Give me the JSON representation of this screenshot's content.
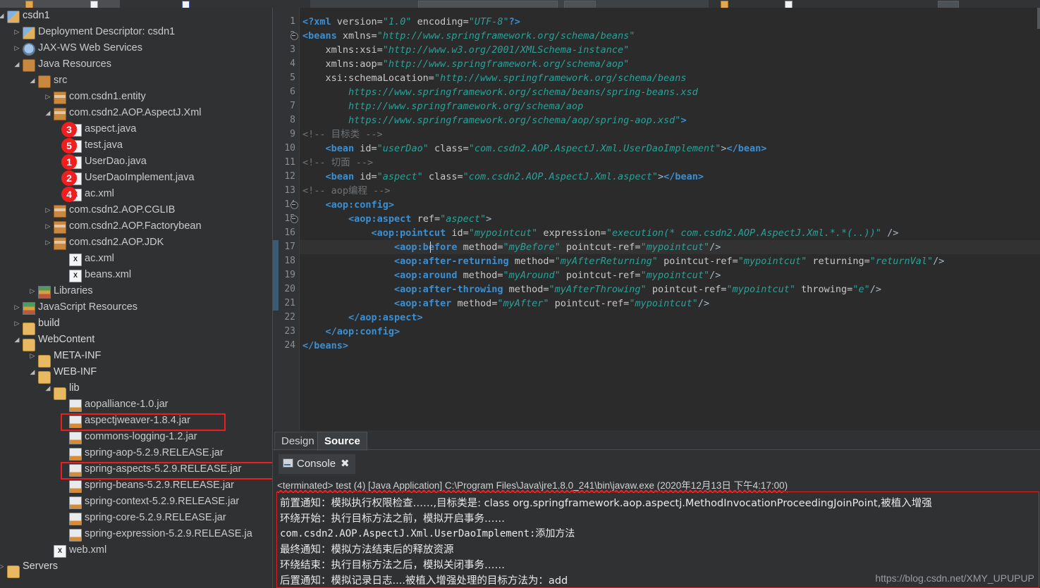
{
  "window": {
    "watermark": "https://blog.csdn.net/XMY_UPUPUP"
  },
  "explorer": {
    "name": "package-explorer",
    "rows": [
      {
        "label": "csdn1",
        "icon": "project-icon",
        "arrow": "◢",
        "indent": 0
      },
      {
        "label": "Deployment Descriptor: csdn1",
        "icon": "deployment-descriptor-icon",
        "arrow": "▷",
        "indent": 1
      },
      {
        "label": "JAX-WS Web Services",
        "icon": "web-services-icon",
        "arrow": "▷",
        "indent": 1
      },
      {
        "label": "Java Resources",
        "icon": "java-resources-icon",
        "arrow": "◢",
        "indent": 1
      },
      {
        "label": "src",
        "icon": "source-folder-icon",
        "arrow": "◢",
        "indent": 2
      },
      {
        "label": "com.csdn1.entity",
        "icon": "package-icon",
        "arrow": "▷",
        "indent": 3
      },
      {
        "label": "com.csdn2.AOP.AspectJ.Xml",
        "icon": "package-icon",
        "arrow": "◢",
        "indent": 3
      },
      {
        "label": "aspect.java",
        "icon": "java-file-icon",
        "arrow": "",
        "indent": 4,
        "badge": "3"
      },
      {
        "label": "test.java",
        "icon": "java-file-icon",
        "arrow": "",
        "indent": 4,
        "badge": "5"
      },
      {
        "label": "UserDao.java",
        "icon": "java-interface-icon",
        "arrow": "",
        "indent": 4,
        "badge": "1"
      },
      {
        "label": "UserDaoImplement.java",
        "icon": "java-file-icon",
        "arrow": "",
        "indent": 4,
        "badge": "2"
      },
      {
        "label": "ac.xml",
        "icon": "xml-file-icon",
        "arrow": "",
        "indent": 4,
        "badge": "4"
      },
      {
        "label": "com.csdn2.AOP.CGLIB",
        "icon": "package-icon",
        "arrow": "▷",
        "indent": 3
      },
      {
        "label": "com.csdn2.AOP.Factorybean",
        "icon": "package-icon",
        "arrow": "▷",
        "indent": 3
      },
      {
        "label": "com.csdn2.AOP.JDK",
        "icon": "package-icon",
        "arrow": "▷",
        "indent": 3
      },
      {
        "label": "ac.xml",
        "icon": "xml-file-icon",
        "arrow": "",
        "indent": 4
      },
      {
        "label": "beans.xml",
        "icon": "xml-file-icon",
        "arrow": "",
        "indent": 4
      },
      {
        "label": "Libraries",
        "icon": "libraries-icon",
        "arrow": "▷",
        "indent": 2
      },
      {
        "label": "JavaScript Resources",
        "icon": "libraries-icon",
        "arrow": "▷",
        "indent": 1
      },
      {
        "label": "build",
        "icon": "folder-icon",
        "arrow": "▷",
        "indent": 1
      },
      {
        "label": "WebContent",
        "icon": "folder-icon",
        "arrow": "◢",
        "indent": 1
      },
      {
        "label": "META-INF",
        "icon": "folder-icon",
        "arrow": "▷",
        "indent": 2
      },
      {
        "label": "WEB-INF",
        "icon": "folder-icon",
        "arrow": "◢",
        "indent": 2
      },
      {
        "label": "lib",
        "icon": "folder-icon",
        "arrow": "◢",
        "indent": 3
      },
      {
        "label": "aopalliance-1.0.jar",
        "icon": "jar-icon",
        "arrow": "",
        "indent": 4
      },
      {
        "label": "aspectjweaver-1.8.4.jar",
        "icon": "jar-icon",
        "arrow": "",
        "indent": 4,
        "highlight": true
      },
      {
        "label": "commons-logging-1.2.jar",
        "icon": "jar-icon",
        "arrow": "",
        "indent": 4
      },
      {
        "label": "spring-aop-5.2.9.RELEASE.jar",
        "icon": "jar-icon",
        "arrow": "",
        "indent": 4
      },
      {
        "label": "spring-aspects-5.2.9.RELEASE.jar",
        "icon": "jar-icon",
        "arrow": "",
        "indent": 4,
        "highlight": true
      },
      {
        "label": "spring-beans-5.2.9.RELEASE.jar",
        "icon": "jar-icon",
        "arrow": "",
        "indent": 4
      },
      {
        "label": "spring-context-5.2.9.RELEASE.jar",
        "icon": "jar-icon",
        "arrow": "",
        "indent": 4
      },
      {
        "label": "spring-core-5.2.9.RELEASE.jar",
        "icon": "jar-icon",
        "arrow": "",
        "indent": 4
      },
      {
        "label": "spring-expression-5.2.9.RELEASE.ja",
        "icon": "jar-icon",
        "arrow": "",
        "indent": 4
      },
      {
        "label": "web.xml",
        "icon": "xml-file-icon",
        "arrow": "",
        "indent": 3
      },
      {
        "label": "Servers",
        "icon": "folder-icon",
        "arrow": "▷",
        "indent": 0
      }
    ]
  },
  "editor": {
    "name": "xml-source-editor",
    "current_line": 17,
    "fold_lines": [
      2,
      14,
      15
    ],
    "lines": [
      {
        "n": "1",
        "segs": [
          {
            "t": "<?",
            "c": "tg"
          },
          {
            "t": "xml",
            "c": "tg"
          },
          {
            "t": " version=",
            "c": "at"
          },
          {
            "t": "\"1.0\"",
            "c": "vl"
          },
          {
            "t": " encoding=",
            "c": "at"
          },
          {
            "t": "\"UTF-8\"",
            "c": "vl"
          },
          {
            "t": "?>",
            "c": "tg"
          }
        ]
      },
      {
        "n": "2",
        "segs": [
          {
            "t": "<beans",
            "c": "tg"
          },
          {
            "t": " xmlns=",
            "c": "at"
          },
          {
            "t": "\"http://www.springframework.org/schema/beans\"",
            "c": "vl"
          }
        ]
      },
      {
        "n": "3",
        "segs": [
          {
            "t": "    xmlns:xsi=",
            "c": "at"
          },
          {
            "t": "\"http://www.w3.org/2001/XMLSchema-instance\"",
            "c": "vl"
          }
        ]
      },
      {
        "n": "4",
        "segs": [
          {
            "t": "    xmlns:aop=",
            "c": "at"
          },
          {
            "t": "\"http://www.springframework.org/schema/aop\"",
            "c": "vl"
          }
        ]
      },
      {
        "n": "5",
        "segs": [
          {
            "t": "    xsi:schemaLocation=",
            "c": "at"
          },
          {
            "t": "\"http://www.springframework.org/schema/beans",
            "c": "vl"
          }
        ]
      },
      {
        "n": "6",
        "segs": [
          {
            "t": "        https://www.springframework.org/schema/beans/spring-beans.xsd",
            "c": "vl"
          }
        ]
      },
      {
        "n": "7",
        "segs": [
          {
            "t": "        http://www.springframework.org/schema/aop",
            "c": "vl"
          }
        ]
      },
      {
        "n": "8",
        "segs": [
          {
            "t": "        https://www.springframework.org/schema/aop/spring-aop.xsd\"",
            "c": "vl"
          },
          {
            "t": ">",
            "c": "tg"
          }
        ]
      },
      {
        "n": "9",
        "segs": [
          {
            "t": "<!-- 目标类 -->",
            "c": "cm"
          }
        ]
      },
      {
        "n": "10",
        "segs": [
          {
            "t": "    <bean",
            "c": "tg"
          },
          {
            "t": " id=",
            "c": "at"
          },
          {
            "t": "\"userDao\"",
            "c": "vl"
          },
          {
            "t": " class=",
            "c": "at"
          },
          {
            "t": "\"com.csdn2.AOP.AspectJ.Xml.UserDaoImplement\"",
            "c": "vl"
          },
          {
            "t": ">",
            "c": "pl"
          },
          {
            "t": "</bean>",
            "c": "tg"
          }
        ]
      },
      {
        "n": "11",
        "segs": [
          {
            "t": "<!-- 切面 -->",
            "c": "cm"
          }
        ]
      },
      {
        "n": "12",
        "segs": [
          {
            "t": "    <bean",
            "c": "tg"
          },
          {
            "t": " id=",
            "c": "at"
          },
          {
            "t": "\"aspect\"",
            "c": "vl"
          },
          {
            "t": " class=",
            "c": "at"
          },
          {
            "t": "\"com.csdn2.AOP.AspectJ.Xml.aspect\"",
            "c": "vl"
          },
          {
            "t": ">",
            "c": "pl"
          },
          {
            "t": "</bean>",
            "c": "tg"
          }
        ]
      },
      {
        "n": "13",
        "segs": [
          {
            "t": "<!-- aop编程 -->",
            "c": "cm"
          }
        ]
      },
      {
        "n": "14",
        "segs": [
          {
            "t": "    <aop:config>",
            "c": "tg"
          }
        ]
      },
      {
        "n": "15",
        "segs": [
          {
            "t": "        <aop:aspect",
            "c": "tg"
          },
          {
            "t": " ref=",
            "c": "at"
          },
          {
            "t": "\"aspect\"",
            "c": "vl"
          },
          {
            "t": ">",
            "c": "pl"
          }
        ]
      },
      {
        "n": "16",
        "segs": [
          {
            "t": "            <aop:pointcut",
            "c": "tg"
          },
          {
            "t": " id=",
            "c": "at"
          },
          {
            "t": "\"mypointcut\"",
            "c": "vl"
          },
          {
            "t": " expression=",
            "c": "at"
          },
          {
            "t": "\"execution(* com.csdn2.AOP.AspectJ.Xml.*.*(..))\"",
            "c": "vl"
          },
          {
            "t": " />",
            "c": "pl"
          }
        ]
      },
      {
        "n": "17",
        "segs": [
          {
            "t": "                <aop:before",
            "c": "tg"
          },
          {
            "t": " method=",
            "c": "at"
          },
          {
            "t": "\"myBefore\"",
            "c": "vl"
          },
          {
            "t": " pointcut-ref=",
            "c": "at"
          },
          {
            "t": "\"mypointcut\"",
            "c": "vl"
          },
          {
            "t": "/>",
            "c": "pl"
          }
        ]
      },
      {
        "n": "18",
        "segs": [
          {
            "t": "                <aop:after-returning",
            "c": "tg"
          },
          {
            "t": " method=",
            "c": "at"
          },
          {
            "t": "\"myAfterReturning\"",
            "c": "vl"
          },
          {
            "t": " pointcut-ref=",
            "c": "at"
          },
          {
            "t": "\"mypointcut\"",
            "c": "vl"
          },
          {
            "t": " returning=",
            "c": "at"
          },
          {
            "t": "\"returnVal\"",
            "c": "vl"
          },
          {
            "t": "/>",
            "c": "pl"
          }
        ]
      },
      {
        "n": "19",
        "segs": [
          {
            "t": "                <aop:around",
            "c": "tg"
          },
          {
            "t": " method=",
            "c": "at"
          },
          {
            "t": "\"myAround\"",
            "c": "vl"
          },
          {
            "t": " pointcut-ref=",
            "c": "at"
          },
          {
            "t": "\"mypointcut\"",
            "c": "vl"
          },
          {
            "t": "/>",
            "c": "pl"
          }
        ]
      },
      {
        "n": "20",
        "segs": [
          {
            "t": "                <aop:after-throwing",
            "c": "tg"
          },
          {
            "t": " method=",
            "c": "at"
          },
          {
            "t": "\"myAfterThrowing\"",
            "c": "vl"
          },
          {
            "t": " pointcut-ref=",
            "c": "at"
          },
          {
            "t": "\"mypointcut\"",
            "c": "vl"
          },
          {
            "t": " throwing=",
            "c": "at"
          },
          {
            "t": "\"e\"",
            "c": "vl"
          },
          {
            "t": "/>",
            "c": "pl"
          }
        ]
      },
      {
        "n": "21",
        "segs": [
          {
            "t": "                <aop:after",
            "c": "tg"
          },
          {
            "t": " method=",
            "c": "at"
          },
          {
            "t": "\"myAfter\"",
            "c": "vl"
          },
          {
            "t": " pointcut-ref=",
            "c": "at"
          },
          {
            "t": "\"mypointcut\"",
            "c": "vl"
          },
          {
            "t": "/>",
            "c": "pl"
          }
        ]
      },
      {
        "n": "22",
        "segs": [
          {
            "t": "        </aop:aspect>",
            "c": "tg"
          }
        ]
      },
      {
        "n": "23",
        "segs": [
          {
            "t": "    </aop:config>",
            "c": "tg"
          }
        ]
      },
      {
        "n": "24",
        "segs": [
          {
            "t": "</beans>",
            "c": "tg"
          }
        ]
      }
    ]
  },
  "design_source_tabs": {
    "design_label": "Design",
    "source_label": "Source",
    "selected": "Source"
  },
  "console": {
    "tab_label": "Console",
    "close_glyph": "✖",
    "terminated_line": "<terminated> test (4) [Java Application] C:\\Program Files\\Java\\jre1.8.0_241\\bin\\javaw.exe (2020年12月13日 下午4:17:00)",
    "output": [
      "前置通知：模拟执行权限检查……,目标类是: class org.springframework.aop.aspectj.MethodInvocationProceedingJoinPoint,被植入增强",
      "环绕开始：执行目标方法之前，模拟开启事务……",
      "com.csdn2.AOP.AspectJ.Xml.UserDaoImplement:添加方法",
      "最终通知：模拟方法结束后的释放资源",
      "环绕结束：执行目标方法之后，模拟关闭事务……",
      "后置通知：模拟记录日志....被植入增强处理的目标方法为：add"
    ]
  },
  "colors": {
    "accent_red": "#ee1c1c",
    "tag_blue": "#3d8fd1",
    "value_green": "#2aa198",
    "editor_bg": "#2b2b2b",
    "panel_bg": "#2f3133"
  }
}
